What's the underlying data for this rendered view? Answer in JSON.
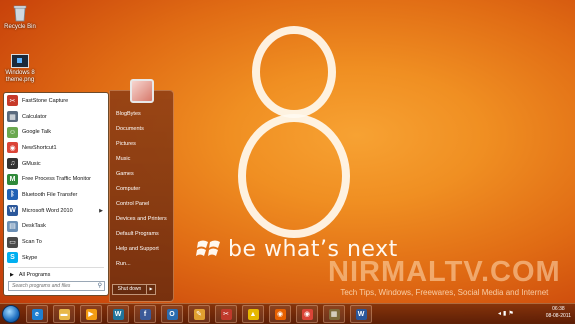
{
  "desktop": {
    "icons": [
      {
        "label": "Recycle Bin",
        "icon": "recycle-bin-icon"
      },
      {
        "label": "Windows 8 theme.png",
        "icon": "image-file-icon"
      }
    ]
  },
  "wallpaper": {
    "tagline": "be what’s next",
    "watermark_brand": "NIRMALTV.COM",
    "watermark_sub": "Tech Tips, Windows, Freewares, Social Media and Internet"
  },
  "start_menu": {
    "programs": [
      {
        "label": "FastStone Capture",
        "icon": "faststone-icon",
        "color": "#c73a2a",
        "glyph": "✂"
      },
      {
        "label": "Calculator",
        "icon": "calculator-icon",
        "color": "#5a6a7e",
        "glyph": "▦"
      },
      {
        "label": "Google Talk",
        "icon": "google-talk-icon",
        "color": "#6aa84f",
        "glyph": "☺"
      },
      {
        "label": "NewShortcut1",
        "icon": "chrome-icon",
        "color": "#db4437",
        "glyph": "◉"
      },
      {
        "label": "GMusic",
        "icon": "headphones-icon",
        "color": "#333333",
        "glyph": "♫"
      },
      {
        "label": "Free Process Traffic Monitor",
        "icon": "traffic-monitor-icon",
        "color": "#2f8a3a",
        "glyph": "M"
      },
      {
        "label": "Bluetooth File Transfer",
        "icon": "bluetooth-icon",
        "color": "#2061b5",
        "glyph": "ᛒ"
      },
      {
        "label": "Microsoft Word 2010",
        "icon": "word-icon",
        "color": "#2b579a",
        "glyph": "W",
        "has_submenu": true
      },
      {
        "label": "DeskTask",
        "icon": "desktask-icon",
        "color": "#6b8fb5",
        "glyph": "▤"
      },
      {
        "label": "Scan To",
        "icon": "scanner-icon",
        "color": "#4a4a4a",
        "glyph": "▭"
      },
      {
        "label": "Skype",
        "icon": "skype-icon",
        "color": "#00aff0",
        "glyph": "S"
      }
    ],
    "all_programs": "All Programs",
    "search_placeholder": "Search programs and files",
    "right_links": [
      "BlogBytes",
      "Documents",
      "Pictures",
      "Music",
      "Games",
      "Computer",
      "Control Panel",
      "Devices and Printers",
      "Default Programs",
      "Help and Support",
      "Run..."
    ],
    "shutdown_label": "Shut down"
  },
  "taskbar": {
    "buttons": [
      {
        "icon": "internet-explorer-icon",
        "color": "#1e7fd0",
        "glyph": "e"
      },
      {
        "icon": "folder-icon",
        "color": "#e8b84a",
        "glyph": "▬"
      },
      {
        "icon": "media-player-icon",
        "color": "#f39c12",
        "glyph": "▶"
      },
      {
        "icon": "wordpress-icon",
        "color": "#21759b",
        "glyph": "W"
      },
      {
        "icon": "facebook-icon",
        "color": "#3b5998",
        "glyph": "f"
      },
      {
        "icon": "outlook-icon",
        "color": "#2b6cb0",
        "glyph": "O"
      },
      {
        "icon": "paint-icon",
        "color": "#e0a030",
        "glyph": "✎"
      },
      {
        "icon": "snipping-tool-icon",
        "color": "#c0392b",
        "glyph": "✂"
      },
      {
        "icon": "bird-app-icon",
        "color": "#e6b800",
        "glyph": "▲"
      },
      {
        "icon": "firefox-icon",
        "color": "#e66000",
        "glyph": "◉"
      },
      {
        "icon": "chrome-icon",
        "color": "#db4437",
        "glyph": "◉"
      },
      {
        "icon": "file-manager-icon",
        "color": "#7d6a3a",
        "glyph": "▦"
      },
      {
        "icon": "word-icon",
        "color": "#2b579a",
        "glyph": "W"
      }
    ],
    "time": "06:38",
    "date": "08-08-2011"
  }
}
